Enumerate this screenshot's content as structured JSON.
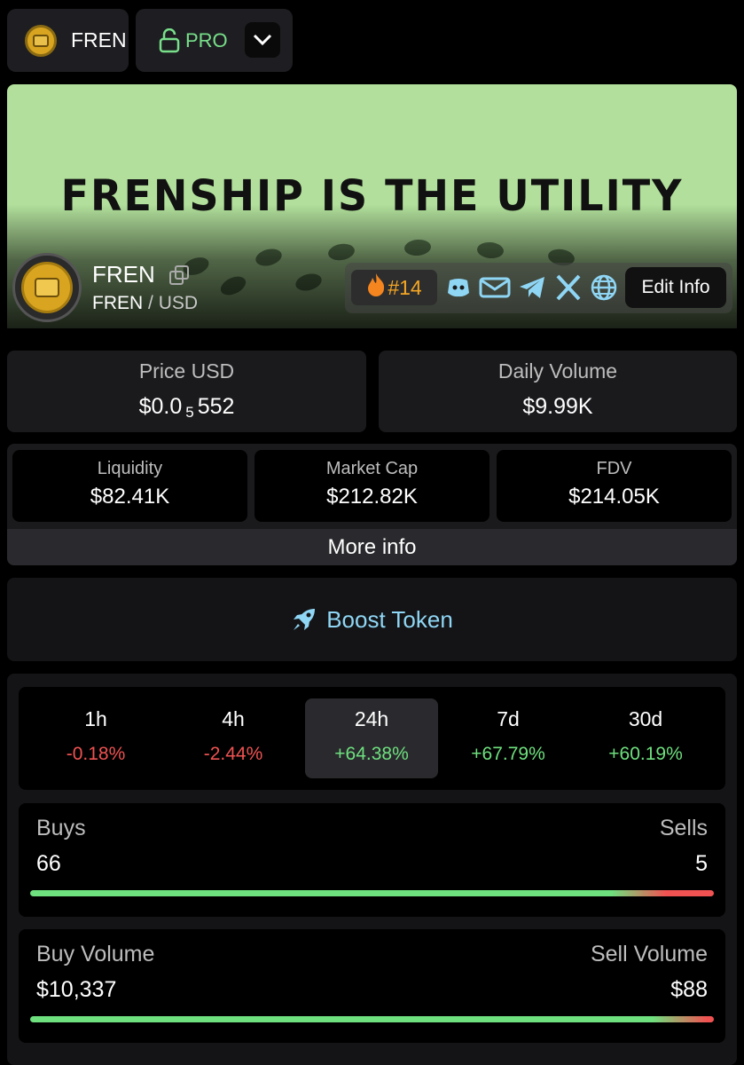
{
  "header": {
    "token_chip_label": "FREN",
    "pro_label": "PRO",
    "icons": {
      "lock": "lock-open-icon",
      "chevron": "chevron-down-icon"
    }
  },
  "banner": {
    "text": "FRENSHIP IS THE UTILITY",
    "token_name": "FREN",
    "pair_base": "FREN",
    "pair_sep": "/",
    "pair_quote": "USD",
    "rank": "#14",
    "edit_info": "Edit Info",
    "bg_color": "#b2e09c"
  },
  "stats": {
    "price_label": "Price USD",
    "price_prefix": "$0.0",
    "price_sub": "5",
    "price_digits": "552",
    "volume_label": "Daily Volume",
    "volume_value": "$9.99K",
    "liquidity_label": "Liquidity",
    "liquidity_value": "$82.41K",
    "mcap_label": "Market Cap",
    "mcap_value": "$212.82K",
    "fdv_label": "FDV",
    "fdv_value": "$214.05K",
    "more_info": "More info"
  },
  "boost": {
    "label": "Boost Token"
  },
  "timeframes": [
    {
      "period": "1h",
      "change": "-0.18%",
      "dir": "neg"
    },
    {
      "period": "4h",
      "change": "-2.44%",
      "dir": "neg"
    },
    {
      "period": "24h",
      "change": "+64.38%",
      "dir": "pos"
    },
    {
      "period": "7d",
      "change": "+67.79%",
      "dir": "pos"
    },
    {
      "period": "30d",
      "change": "+60.19%",
      "dir": "pos"
    }
  ],
  "selected_timeframe": "24h",
  "txns": {
    "buys_label": "Buys",
    "buys_value": "66",
    "sells_label": "Sells",
    "sells_value": "5",
    "buy_share": 0.93
  },
  "volume": {
    "buy_label": "Buy Volume",
    "buy_value": "$10,337",
    "sell_label": "Sell Volume",
    "sell_value": "$88",
    "buy_share": 0.99
  },
  "colors": {
    "positive": "#6ee07e",
    "negative": "#f05252",
    "accent": "#8fd6f5",
    "rank": "#f5a623"
  }
}
